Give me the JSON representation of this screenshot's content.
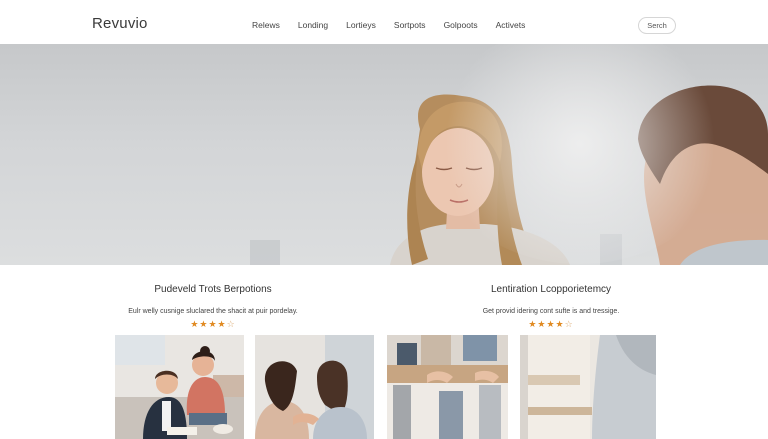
{
  "header": {
    "brand": "Revuvio",
    "nav": [
      "Relews",
      "Londing",
      "Lortieys",
      "Sortpots",
      "Golpoots",
      "Activets"
    ],
    "search_label": "Serch"
  },
  "features": [
    {
      "title": "Pudeveld Trots Berpotions",
      "desc": "Eulr welly cusnige sluclared the shacit at puir pordelay.",
      "rating": 4.5
    },
    {
      "title": "Lentiration Lcopporietemcy",
      "desc": "Get provid idering cont sufte is and tressige.",
      "rating": 4.5
    }
  ],
  "stars": {
    "full": "★★★★",
    "empty": "☆"
  },
  "colors": {
    "accent_star": "#e08a22",
    "hero_bg": "#d3d5d7",
    "text": "#333333"
  }
}
